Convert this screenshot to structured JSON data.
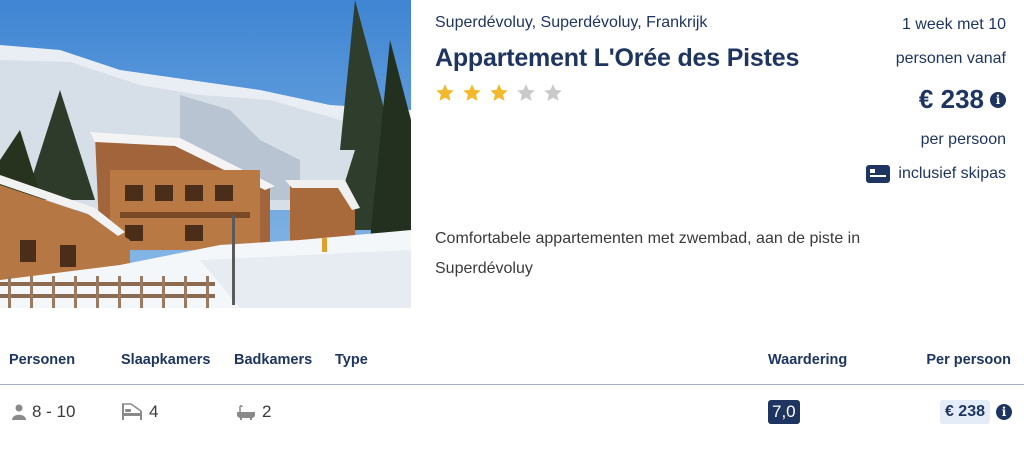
{
  "listing": {
    "image_alt": "Wooden chalets in snowy mountains",
    "location": "Superdévoluy, Superdévoluy, Frankrijk",
    "title": "Appartement L'Orée des Pistes",
    "stars_filled": 3,
    "stars_total": 5,
    "description": "Comfortabele appartementen met zwembad, aan de piste in Superdévoluy"
  },
  "price_block": {
    "duration": "1 week met 10",
    "persons_from": "personen vanaf",
    "price": "€ 238",
    "per_person": "per persoon",
    "includes": "inclusief skipas",
    "info_icon": "info-icon",
    "skipas_icon": "card-icon"
  },
  "table": {
    "headers": {
      "persons": "Personen",
      "bedrooms": "Slaapkamers",
      "bathrooms": "Badkamers",
      "type": "Type",
      "rating": "Waardering",
      "price": "Per persoon"
    },
    "row": {
      "persons": "8 - 10",
      "bedrooms": "4",
      "bathrooms": "2",
      "type": "",
      "rating": "7,0",
      "price": "€ 238"
    }
  },
  "colors": {
    "brand": "#1f3561",
    "star_on": "#f2b92c",
    "star_off": "#c9c9c9",
    "price_badge_bg": "#e3ecf7"
  }
}
